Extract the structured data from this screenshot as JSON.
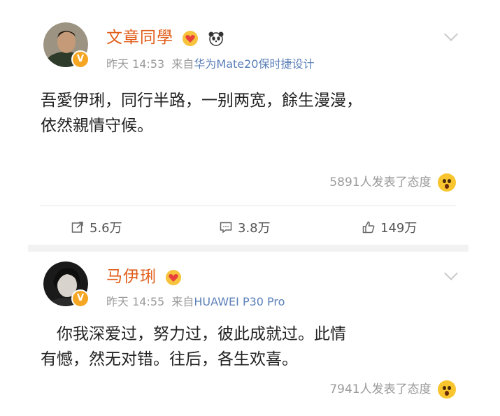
{
  "posts": [
    {
      "author": "文章同學",
      "time": "昨天 14:53",
      "source_prefix": "来自",
      "source": "华为Mate20保时捷设计",
      "content_lines": [
        "吾愛伊琍，同行半路，一别两宽，餘生漫漫，",
        "依然親情守候。"
      ],
      "reaction_text": "5891人发表了态度",
      "actions": {
        "repost": "5.6万",
        "comment": "3.8万",
        "like": "149万"
      }
    },
    {
      "author": "马伊琍",
      "time": "昨天 14:55",
      "source_prefix": "来自",
      "source": "HUAWEI P30 Pro",
      "content_lines": [
        "　你我深爱过，努力过，彼此成就过。此情",
        "有憾，然无对错。往后，各生欢喜。"
      ],
      "reaction_text": "7941人发表了态度"
    }
  ],
  "colors": {
    "author": "#e05d18",
    "source_link": "#5a7fb8",
    "meta": "#9a9a9a"
  }
}
